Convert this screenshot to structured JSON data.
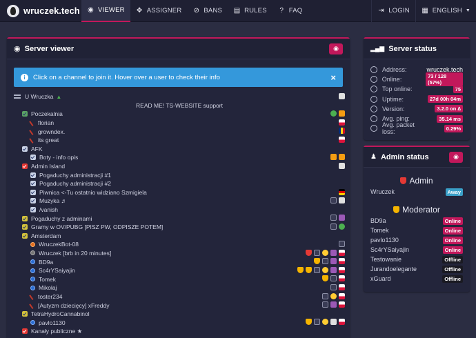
{
  "nav": {
    "brand": "wruczek.tech",
    "items": [
      {
        "label": "VIEWER",
        "icon": "eye-icon",
        "active": true
      },
      {
        "label": "ASSIGNER",
        "icon": "gamepad-icon",
        "active": false
      },
      {
        "label": "BANS",
        "icon": "ban-icon",
        "active": false
      },
      {
        "label": "RULES",
        "icon": "book-icon",
        "active": false
      },
      {
        "label": "FAQ",
        "icon": "question-icon",
        "active": false
      }
    ],
    "login": "LOGIN",
    "language": "ENGLISH"
  },
  "viewer": {
    "title": "Server viewer",
    "alert": "Click on a channel to join it. Hover over a user to check their info",
    "server_name": "U Wruczka",
    "banner": "READ ME! TS-WEBSITE support",
    "tree": [
      {
        "type": "channel",
        "label": "Poczekalnia",
        "indent": 1,
        "icon": "green",
        "badges": [
          "ico-g",
          "ico-o"
        ]
      },
      {
        "type": "user",
        "label": "florian",
        "indent": 2,
        "icon": "mic",
        "badges": [
          "flag-pl"
        ]
      },
      {
        "type": "user",
        "label": "growndex.",
        "indent": 2,
        "icon": "mic",
        "badges": [
          "flag-ro"
        ]
      },
      {
        "type": "user",
        "label": "its great",
        "indent": 2,
        "icon": "mic",
        "badges": [
          "flag-pl"
        ]
      },
      {
        "type": "channel",
        "label": "AFK",
        "indent": 1,
        "icon": "blue",
        "badges": []
      },
      {
        "type": "channel",
        "label": "Boty - info opis",
        "indent": 2,
        "icon": "blue",
        "badges": [
          "ico-o",
          "ico-o"
        ]
      },
      {
        "type": "channel",
        "label": "Admin Island",
        "indent": 1,
        "icon": "red",
        "badges": [
          "ico-k"
        ]
      },
      {
        "type": "channel",
        "label": "Pogaduchy administracji #1",
        "indent": 2,
        "icon": "blue",
        "badges": []
      },
      {
        "type": "channel",
        "label": "Pogaduchy administracji #2",
        "indent": 2,
        "icon": "blue",
        "badges": []
      },
      {
        "type": "channel",
        "label": "Piwnica <-Tu ostatnio widziano Szmigiela",
        "indent": 2,
        "icon": "blue",
        "badges": [
          "flag-de"
        ]
      },
      {
        "type": "channel",
        "label": "Muzyka ♬",
        "indent": 2,
        "icon": "blue",
        "badges": [
          "ico-w",
          "ico-k"
        ]
      },
      {
        "type": "channel",
        "label": "/vanish",
        "indent": 2,
        "icon": "blue",
        "badges": []
      },
      {
        "type": "channel",
        "label": "Pogaduchy z adminami",
        "indent": 1,
        "icon": "yellow",
        "badges": [
          "ico-w",
          "ico-p"
        ]
      },
      {
        "type": "channel",
        "label": "Gramy w OV/PUBG [PISZ PW, ODPISZE POTEM]",
        "indent": 1,
        "icon": "yellow",
        "badges": [
          "ico-w",
          "ico-g"
        ]
      },
      {
        "type": "channel",
        "label": "Amsterdam",
        "indent": 1,
        "icon": "yellow",
        "badges": []
      },
      {
        "type": "user",
        "label": "WruczekBot-08",
        "indent": 2,
        "icon": "dot-orange",
        "badges": [
          "ico-w"
        ]
      },
      {
        "type": "user",
        "label": "Wruczek [brb in 20 minutes]",
        "indent": 2,
        "icon": "dot-grey",
        "badges": [
          "shield-r",
          "ico-w",
          "ico-y",
          "ico-p",
          "flag-pl"
        ]
      },
      {
        "type": "user",
        "label": "BD9a",
        "indent": 2,
        "icon": "dot",
        "badges": [
          "shield-y",
          "ico-w",
          "ico-p",
          "flag-pl"
        ]
      },
      {
        "type": "user",
        "label": "Sc4rYSaiyajin",
        "indent": 2,
        "icon": "dot",
        "badges": [
          "shield-y",
          "shield-y",
          "ico-w",
          "ico-y",
          "ico-p",
          "flag-pl"
        ]
      },
      {
        "type": "user",
        "label": "Tomek",
        "indent": 2,
        "icon": "dot",
        "badges": [
          "shield-y",
          "ico-w",
          "flag-pl"
        ]
      },
      {
        "type": "user",
        "label": "Mikołaj",
        "indent": 2,
        "icon": "dot",
        "badges": [
          "ico-w",
          "flag-pl"
        ]
      },
      {
        "type": "user",
        "label": "toster234",
        "indent": 2,
        "icon": "mic",
        "badges": [
          "ico-w",
          "ico-y",
          "flag-pl"
        ]
      },
      {
        "type": "user",
        "label": "[Autyzm dziecięcy] xFreddy",
        "indent": 2,
        "icon": "mic",
        "badges": [
          "ico-w",
          "ico-p",
          "flag-pl"
        ]
      },
      {
        "type": "channel",
        "label": "TetraHydroCannabinol",
        "indent": 1,
        "icon": "yellow",
        "badges": []
      },
      {
        "type": "user",
        "label": "pavlo1130",
        "indent": 2,
        "icon": "dot",
        "badges": [
          "shield-y",
          "ico-w",
          "ico-y",
          "ico-k",
          "flag-pl"
        ]
      },
      {
        "type": "channel",
        "label": "Kanały publiczne ★",
        "indent": 1,
        "icon": "red",
        "badges": []
      }
    ]
  },
  "status": {
    "title": "Server status",
    "rows": [
      {
        "label": "Address:",
        "value": "wruczek.tech",
        "pill": false
      },
      {
        "label": "Online:",
        "value": "73 / 128 (57%)",
        "pill": true
      },
      {
        "label": "Top online:",
        "value": "75",
        "pill": true
      },
      {
        "label": "Uptime:",
        "value": "27d 00h 04m",
        "pill": true
      },
      {
        "label": "Version:",
        "value": "3.2.0 on ∆",
        "pill": true
      },
      {
        "label": "Avg. ping:",
        "value": "35.14 ms",
        "pill": true
      },
      {
        "label": "Avg. packet loss:",
        "value": "0.29%",
        "pill": true
      }
    ]
  },
  "admin": {
    "title": "Admin status",
    "groups": [
      {
        "name": "Admin",
        "color": "#e53935",
        "members": [
          {
            "name": "Wruczek",
            "status": "Away",
            "kind": "away"
          }
        ]
      },
      {
        "name": "Moderator",
        "color": "#f5b400",
        "members": [
          {
            "name": "BD9a",
            "status": "Online",
            "kind": "online"
          },
          {
            "name": "Tomek",
            "status": "Online",
            "kind": "online"
          },
          {
            "name": "pavlo1130",
            "status": "Online",
            "kind": "online"
          },
          {
            "name": "Sc4rYSaiyajin",
            "status": "Online",
            "kind": "online"
          },
          {
            "name": "Testowanie",
            "status": "Offline",
            "kind": "offline"
          },
          {
            "name": "Jurandoelegante",
            "status": "Offline",
            "kind": "offline"
          },
          {
            "name": "xGuard",
            "status": "Offline",
            "kind": "offline"
          }
        ]
      }
    ]
  }
}
